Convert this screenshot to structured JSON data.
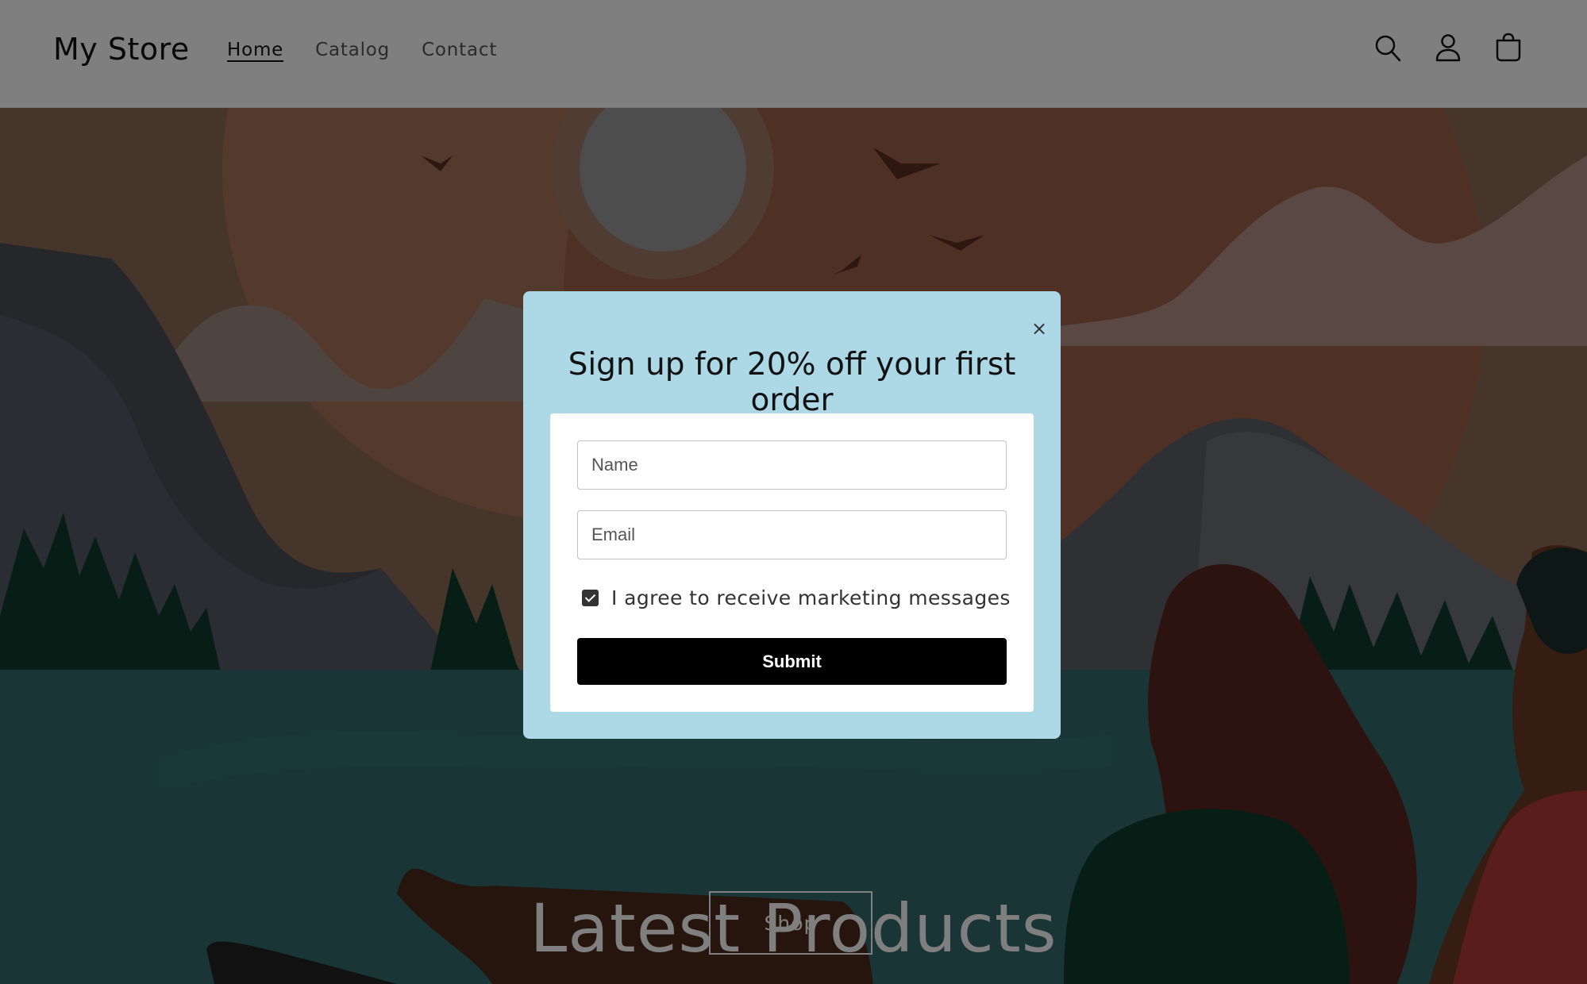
{
  "header": {
    "logo": "My Store",
    "nav": [
      {
        "label": "Home",
        "active": true
      },
      {
        "label": "Catalog",
        "active": false
      },
      {
        "label": "Contact",
        "active": false
      }
    ],
    "icons": [
      "search-icon",
      "account-icon",
      "cart-icon"
    ]
  },
  "hero": {
    "title": "Latest Products",
    "button_label": "Shop"
  },
  "modal": {
    "close_label": "×",
    "title": "Sign up for 20% off your first order",
    "name_placeholder": "Name",
    "email_placeholder": "Email",
    "consent_label": "I agree to receive marketing messages",
    "consent_checked": true,
    "submit_label": "Submit",
    "background_color": "#add8e6"
  }
}
